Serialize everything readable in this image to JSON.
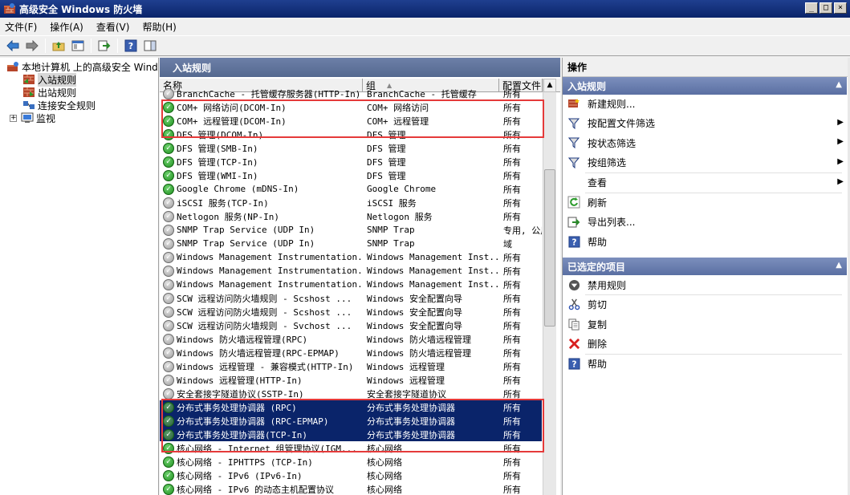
{
  "window": {
    "title": "高级安全 Windows 防火墙",
    "min_label": "_",
    "max_label": "□",
    "close_label": "×"
  },
  "menu": [
    "文件(F)",
    "操作(A)",
    "查看(V)",
    "帮助(H)"
  ],
  "tree": {
    "root": "本地计算机 上的高级安全 Windows 防火墙",
    "items": [
      "入站规则",
      "出站规则",
      "连接安全规则",
      "监视"
    ],
    "expander": "+"
  },
  "middle": {
    "header": "入站规则",
    "columns": [
      "名称",
      "组",
      "配置文件"
    ],
    "rows": [
      {
        "name": "BranchCache - 托管缓存服务器(HTTP-In)",
        "group": "BranchCache - 托管缓存",
        "profile": "所有",
        "enabled": false
      },
      {
        "name": "COM+ 网络访问(DCOM-In)",
        "group": "COM+ 网络访问",
        "profile": "所有",
        "enabled": true
      },
      {
        "name": "COM+ 远程管理(DCOM-In)",
        "group": "COM+ 远程管理",
        "profile": "所有",
        "enabled": true
      },
      {
        "name": "DFS 管理(DCOM-In)",
        "group": "DFS 管理",
        "profile": "所有",
        "enabled": true
      },
      {
        "name": "DFS 管理(SMB-In)",
        "group": "DFS 管理",
        "profile": "所有",
        "enabled": true
      },
      {
        "name": "DFS 管理(TCP-In)",
        "group": "DFS 管理",
        "profile": "所有",
        "enabled": true
      },
      {
        "name": "DFS 管理(WMI-In)",
        "group": "DFS 管理",
        "profile": "所有",
        "enabled": true
      },
      {
        "name": "Google Chrome (mDNS-In)",
        "group": "Google Chrome",
        "profile": "所有",
        "enabled": true
      },
      {
        "name": "iSCSI 服务(TCP-In)",
        "group": "iSCSI 服务",
        "profile": "所有",
        "enabled": false
      },
      {
        "name": "Netlogon 服务(NP-In)",
        "group": "Netlogon 服务",
        "profile": "所有",
        "enabled": false
      },
      {
        "name": "SNMP Trap Service (UDP In)",
        "group": "SNMP Trap",
        "profile": "专用, 公用",
        "enabled": false
      },
      {
        "name": "SNMP Trap Service (UDP In)",
        "group": "SNMP Trap",
        "profile": "域",
        "enabled": false
      },
      {
        "name": "Windows Management Instrumentation...",
        "group": "Windows Management Inst...",
        "profile": "所有",
        "enabled": false
      },
      {
        "name": "Windows Management Instrumentation...",
        "group": "Windows Management Inst...",
        "profile": "所有",
        "enabled": false
      },
      {
        "name": "Windows Management Instrumentation...",
        "group": "Windows Management Inst...",
        "profile": "所有",
        "enabled": false
      },
      {
        "name": "SCW 远程访问防火墙规则 - Scshost ...",
        "group": "Windows 安全配置向导",
        "profile": "所有",
        "enabled": false
      },
      {
        "name": "SCW 远程访问防火墙规则 - Scshost ...",
        "group": "Windows 安全配置向导",
        "profile": "所有",
        "enabled": false
      },
      {
        "name": "SCW 远程访问防火墙规则 - Svchost ...",
        "group": "Windows 安全配置向导",
        "profile": "所有",
        "enabled": false
      },
      {
        "name": "Windows 防火墙远程管理(RPC)",
        "group": "Windows 防火墙远程管理",
        "profile": "所有",
        "enabled": false
      },
      {
        "name": "Windows 防火墙远程管理(RPC-EPMAP)",
        "group": "Windows 防火墙远程管理",
        "profile": "所有",
        "enabled": false
      },
      {
        "name": "Windows 远程管理 - 兼容模式(HTTP-In)",
        "group": "Windows 远程管理",
        "profile": "所有",
        "enabled": false
      },
      {
        "name": "Windows 远程管理(HTTP-In)",
        "group": "Windows 远程管理",
        "profile": "所有",
        "enabled": false
      },
      {
        "name": "安全套接字隧道协议(SSTP-In)",
        "group": "安全套接字隧道协议",
        "profile": "所有",
        "enabled": false
      },
      {
        "name": "分布式事务处理协调器 (RPC)",
        "group": "分布式事务处理协调器",
        "profile": "所有",
        "enabled": true,
        "selected": true
      },
      {
        "name": "分布式事务处理协调器 (RPC-EPMAP)",
        "group": "分布式事务处理协调器",
        "profile": "所有",
        "enabled": true,
        "selected": true
      },
      {
        "name": "分布式事务处理协调器(TCP-In)",
        "group": "分布式事务处理协调器",
        "profile": "所有",
        "enabled": true,
        "selected": true
      },
      {
        "name": "核心网络 - Internet 组管理协议(IGM...",
        "group": "核心网络",
        "profile": "所有",
        "enabled": true
      },
      {
        "name": "核心网络 - IPHTTPS (TCP-In)",
        "group": "核心网络",
        "profile": "所有",
        "enabled": true
      },
      {
        "name": "核心网络 - IPv6 (IPv6-In)",
        "group": "核心网络",
        "profile": "所有",
        "enabled": true
      },
      {
        "name": "核心网络 - IPv6 的动态主机配置协议",
        "group": "核心网络",
        "profile": "所有",
        "enabled": true
      }
    ]
  },
  "actions": {
    "header": "操作",
    "section1": "入站规则",
    "items1": [
      {
        "label": "新建规则...",
        "icon": "new-rule-icon",
        "submenu": false
      },
      {
        "label": "按配置文件筛选",
        "icon": "filter-icon",
        "submenu": true
      },
      {
        "label": "按状态筛选",
        "icon": "filter-icon",
        "submenu": true
      },
      {
        "label": "按组筛选",
        "icon": "filter-icon",
        "submenu": true
      },
      {
        "label": "查看",
        "icon": "",
        "submenu": true
      },
      {
        "label": "刷新",
        "icon": "refresh-icon",
        "submenu": false
      },
      {
        "label": "导出列表...",
        "icon": "export-icon",
        "submenu": false
      },
      {
        "label": "帮助",
        "icon": "help-icon",
        "submenu": false
      }
    ],
    "section2": "已选定的项目",
    "items2": [
      {
        "label": "禁用规则",
        "icon": "disable-icon"
      },
      {
        "label": "剪切",
        "icon": "cut-icon"
      },
      {
        "label": "复制",
        "icon": "copy-icon"
      },
      {
        "label": "删除",
        "icon": "delete-icon"
      },
      {
        "label": "帮助",
        "icon": "help-icon"
      }
    ]
  },
  "colors": {
    "titlebar": "#0a246a",
    "selection": "#0a246a",
    "highlight_box": "#e53a3a"
  }
}
